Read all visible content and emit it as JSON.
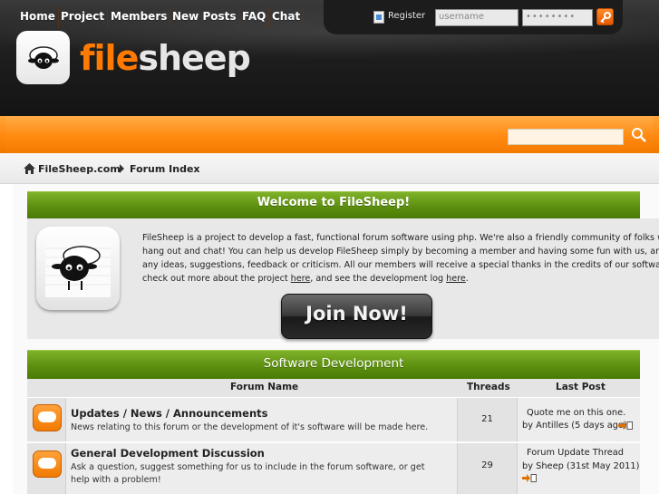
{
  "header": {
    "register_label": "Register",
    "username_placeholder": "username",
    "password_mask": "••••••••",
    "logo_part1": "file",
    "logo_part2": "sheep"
  },
  "nav": {
    "items": [
      "Home",
      "Project",
      "Members",
      "New Posts",
      "FAQ",
      "Chat"
    ]
  },
  "breadcrumb": {
    "home": "FileSheep.com",
    "current": "Forum Index"
  },
  "welcome": {
    "title": "Welcome to FileSheep!",
    "line1": "FileSheep is a project to develop a fast, functional forum software using php. We're also a friendly community of folks who love to",
    "line2": "hang out and chat! You can help us develop FileSheep simply by becoming a member and having some fun with us, and we value",
    "line3": "any ideas, suggestions, feedback or criticism. All our members will receive a special thanks in the credits of our software. You ca",
    "line4_a": "check out more about the project ",
    "link1": "here",
    "line4_b": ", and see the development log ",
    "link2": "here",
    "line4_c": ".",
    "join_label": "Join Now!"
  },
  "section": {
    "title": "Software Development",
    "col_forum": "Forum Name",
    "col_threads": "Threads",
    "col_last": "Last Post",
    "forums": [
      {
        "title": "Updates / News / Announcements",
        "desc": "News relating to this forum or the development of it's software will be made here.",
        "threads": "21",
        "last_title": "Quote me on this one.",
        "last_by": "by Antilles (5 days ago)"
      },
      {
        "title": "General Development Discussion",
        "desc": "Ask a question, suggest something for us to include in the forum software, or get help with a problem!",
        "threads": "29",
        "last_title": "Forum Update Thread",
        "last_by": "by Sheep (31st May 2011)"
      }
    ]
  },
  "colors": {
    "accent_orange": "#ff8a12",
    "section_green": "#5d8f10",
    "header_dark": "#1e1e1e"
  }
}
